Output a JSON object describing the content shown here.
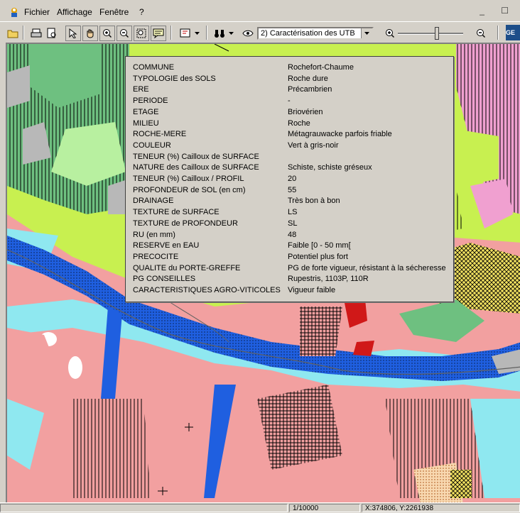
{
  "menubar": {
    "items": [
      "Fichier",
      "Affichage",
      "Fenêtre",
      "?"
    ],
    "window_controls": "_ ☐"
  },
  "toolbar": {
    "layer_select_value": "2) Caractérisation des UTB",
    "logo_text": "GE",
    "icons": [
      "open-folder-icon",
      "print-icon",
      "print-preview-icon",
      "arrow-pointer-icon",
      "hand-pan-icon",
      "zoom-in-icon",
      "zoom-out-icon",
      "zoom-window-icon",
      "info-bubble-icon",
      "identify-icon",
      "binoculars-icon",
      "layer-eye-icon",
      "zoom-in-icon",
      "zoom-out-icon"
    ]
  },
  "popup": {
    "rows": [
      {
        "label": "COMMUNE",
        "value": "Rochefort-Chaume"
      },
      {
        "label": "TYPOLOGIE des SOLS",
        "value": "Roche dure"
      },
      {
        "label": "ERE",
        "value": "Précambrien"
      },
      {
        "label": "PERIODE",
        "value": "-"
      },
      {
        "label": "ETAGE",
        "value": "Briovérien"
      },
      {
        "label": "MILIEU",
        "value": "Roche"
      },
      {
        "label": "ROCHE-MERE",
        "value": "Métagrauwacke parfois friable"
      },
      {
        "label": "COULEUR",
        "value": "Vert à gris-noir"
      },
      {
        "label": "TENEUR (%) Cailloux de SURFACE",
        "value": ""
      },
      {
        "label": "NATURE des Cailloux de SURFACE",
        "value": "Schiste, schiste gréseux"
      },
      {
        "label": "TENEUR (%) Cailloux / PROFIL",
        "value": "20"
      },
      {
        "label": "PROFONDEUR de SOL (en cm)",
        "value": "55"
      },
      {
        "label": "DRAINAGE",
        "value": "Très bon à bon"
      },
      {
        "label": "TEXTURE de SURFACE",
        "value": "LS"
      },
      {
        "label": "TEXTURE de PROFONDEUR",
        "value": "SL"
      },
      {
        "label": "RU (en mm)",
        "value": "48"
      },
      {
        "label": "RESERVE en EAU",
        "value": "Faible [0 - 50 mm["
      },
      {
        "label": "PRECOCITE",
        "value": "Potentiel plus fort"
      },
      {
        "label": "QUALITE du PORTE-GREFFE",
        "value": "PG de forte vigueur, résistant à la sécheresse"
      },
      {
        "label": "PG CONSEILLES",
        "value": "Rupestris, 1103P, 110R"
      },
      {
        "label": "CARACTERISTIQUES AGRO-VITICOLES",
        "value": "Vigueur faible"
      }
    ]
  },
  "statusbar": {
    "scale": "1/10000",
    "coords": "X:374806, Y:2261938"
  },
  "colors": {
    "chrome": "#d4d0c8",
    "soil_pink": "#f2a0a0",
    "river_blue": "#1f5fe0",
    "water_cyan": "#8fe8f0",
    "lime": "#c8f050",
    "light_green": "#b8f0a0",
    "dark_green": "#6ec080",
    "grey": "#b8b8b8",
    "magenta": "#f0a0d0",
    "red": "#d01818"
  }
}
